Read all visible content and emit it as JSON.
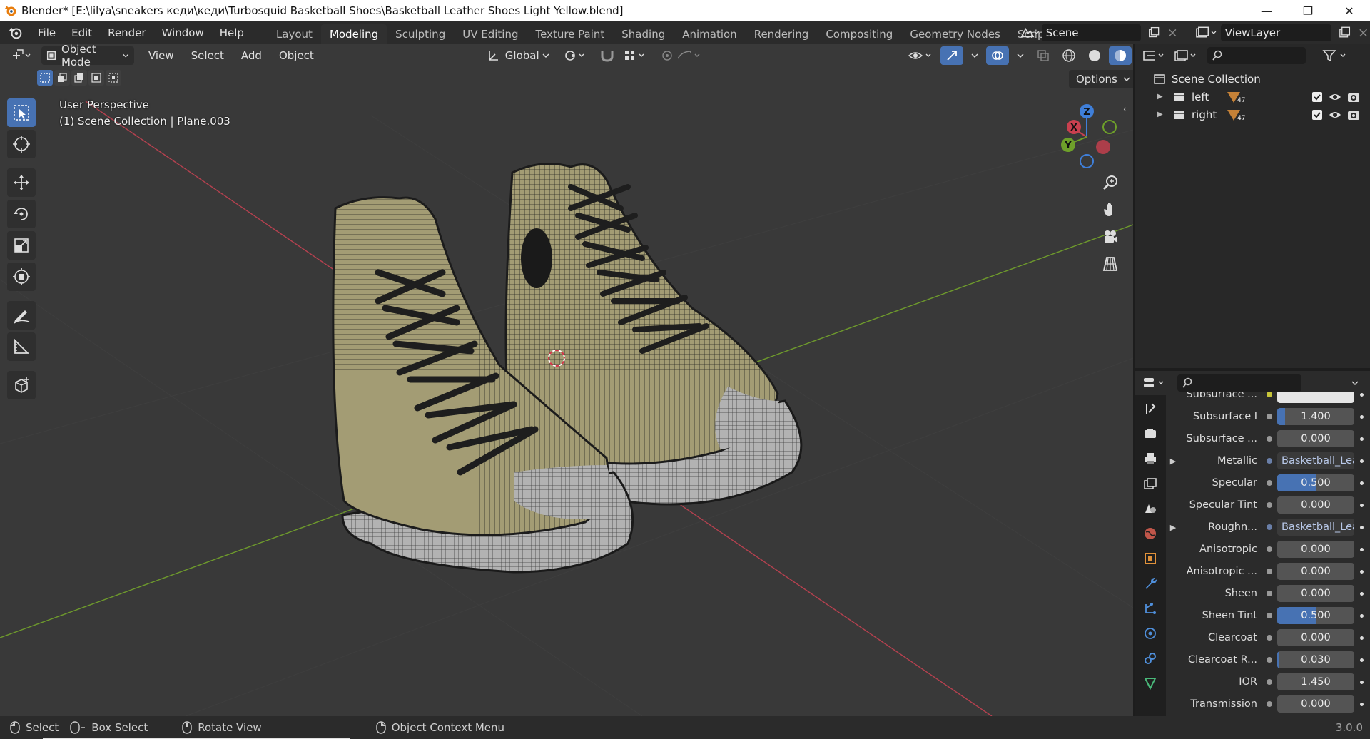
{
  "window": {
    "title": "Blender* [E:\\lilya\\sneakers кеди\\кеди\\Turbosquid Basketball Shoes\\Basketball Leather Shoes Light Yellow.blend]"
  },
  "menu": {
    "items": [
      "File",
      "Edit",
      "Render",
      "Window",
      "Help"
    ]
  },
  "workspaces": {
    "tabs": [
      "Layout",
      "Modeling",
      "Sculpting",
      "UV Editing",
      "Texture Paint",
      "Shading",
      "Animation",
      "Rendering",
      "Compositing",
      "Geometry Nodes",
      "Scripting"
    ],
    "active": "Modeling",
    "add_label": "+"
  },
  "scene": {
    "label": "Scene"
  },
  "viewlayer": {
    "label": "ViewLayer"
  },
  "viewport_header": {
    "mode": "Object Mode",
    "menus": [
      "View",
      "Select",
      "Add",
      "Object"
    ],
    "transform_orientation": "Global",
    "options_label": "Options"
  },
  "viewport_overlay": {
    "line1": "User Perspective",
    "line2": "(1) Scene Collection | Plane.003"
  },
  "gizmo": {
    "x": "X",
    "y": "Y",
    "z": "Z"
  },
  "outliner": {
    "root": "Scene Collection",
    "items": [
      {
        "name": "left",
        "badge": "47"
      },
      {
        "name": "right",
        "badge": "47"
      }
    ]
  },
  "properties": {
    "rows": [
      {
        "label": "Subsurface ...",
        "type": "color",
        "value": ""
      },
      {
        "label": "Subsurface I",
        "type": "number",
        "value": "1.400",
        "fill": 0.1
      },
      {
        "label": "Subsurface ...",
        "type": "number",
        "value": "0.000",
        "fill": 0
      },
      {
        "label": "Metallic",
        "type": "link",
        "value": "Basketball_Lea...",
        "expand": true
      },
      {
        "label": "Specular",
        "type": "number",
        "value": "0.500",
        "fill": 0.5
      },
      {
        "label": "Specular Tint",
        "type": "number",
        "value": "0.000",
        "fill": 0
      },
      {
        "label": "Roughn...",
        "type": "link",
        "value": "Basketball_Lea...",
        "expand": true
      },
      {
        "label": "Anisotropic",
        "type": "number",
        "value": "0.000",
        "fill": 0
      },
      {
        "label": "Anisotropic ...",
        "type": "number",
        "value": "0.000",
        "fill": 0
      },
      {
        "label": "Sheen",
        "type": "number",
        "value": "0.000",
        "fill": 0
      },
      {
        "label": "Sheen Tint",
        "type": "number",
        "value": "0.500",
        "fill": 0.5
      },
      {
        "label": "Clearcoat",
        "type": "number",
        "value": "0.000",
        "fill": 0
      },
      {
        "label": "Clearcoat R...",
        "type": "number",
        "value": "0.030",
        "fill": 0.03
      },
      {
        "label": "IOR",
        "type": "number",
        "value": "1.450",
        "fill": 0
      },
      {
        "label": "Transmission",
        "type": "number",
        "value": "0.000",
        "fill": 0
      }
    ]
  },
  "statusbar": {
    "select": "Select",
    "box_select": "Box Select",
    "rotate_view": "Rotate View",
    "context_menu": "Object Context Menu",
    "version": "3.0.0"
  },
  "colors": {
    "accent": "#4772b3",
    "axis_x": "#c9404f",
    "axis_y": "#6ea02a",
    "axis_z": "#3f7fd9"
  }
}
